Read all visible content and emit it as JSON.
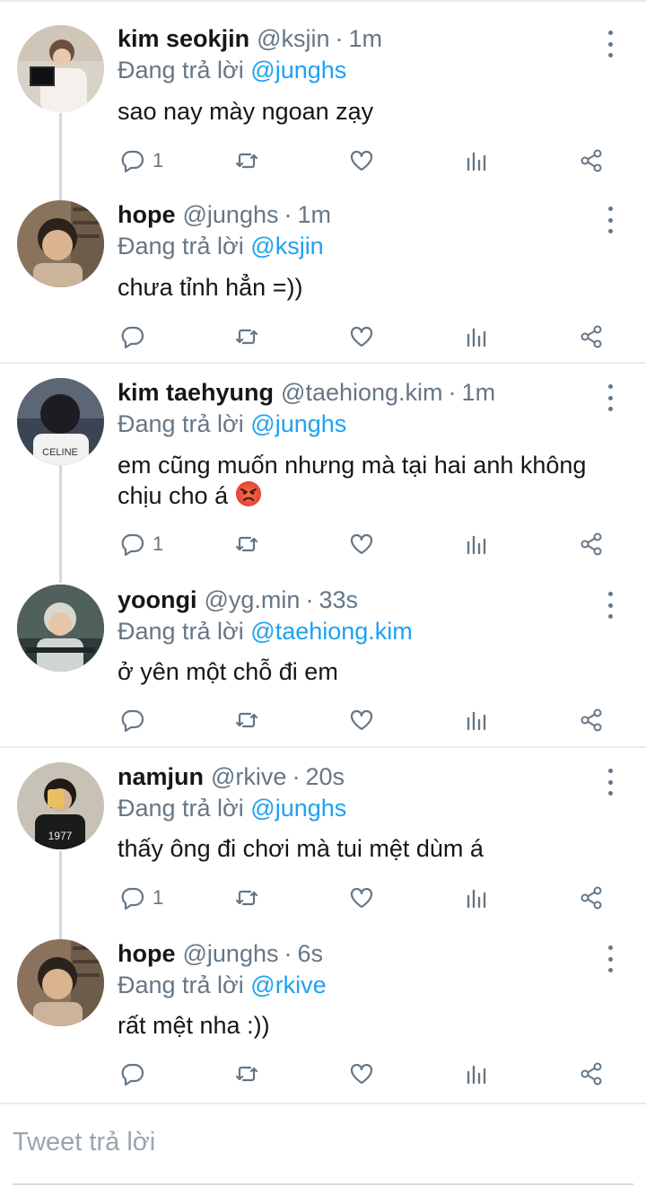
{
  "reply_prefix": "Đang trả lời",
  "compose": {
    "placeholder": "Tweet trả lời"
  },
  "colors": {
    "link": "#1da1f2",
    "muted": "#657786",
    "divider": "#e6ecf0"
  },
  "tweets": [
    {
      "name": "kim seokjin",
      "handle": "@ksjin",
      "time": "1m",
      "reply_to": "@junghs",
      "text": "sao nay mày ngoan zạy",
      "reply_count": "1"
    },
    {
      "name": "hope",
      "handle": "@junghs",
      "time": "1m",
      "reply_to": "@ksjin",
      "text": "chưa tỉnh hẳn =))",
      "reply_count": ""
    },
    {
      "name": "kim taehyung",
      "handle": "@taehiong.kim",
      "time": "1m",
      "reply_to": "@junghs",
      "text": "em cũng muốn nhưng mà tại hai anh không chịu cho á",
      "emoji": "angry-face",
      "reply_count": "1"
    },
    {
      "name": "yoongi",
      "handle": "@yg.min",
      "time": "33s",
      "reply_to": "@taehiong.kim",
      "text": "ở yên một chỗ đi em",
      "reply_count": ""
    },
    {
      "name": "namjun",
      "handle": "@rkive",
      "time": "20s",
      "reply_to": "@junghs",
      "text": "thấy ông đi chơi mà tui mệt dùm á",
      "reply_count": "1"
    },
    {
      "name": "hope",
      "handle": "@junghs",
      "time": "6s",
      "reply_to": "@rkive",
      "text": "rất mệt nha :))",
      "reply_count": ""
    }
  ],
  "separators": [
    "·"
  ]
}
